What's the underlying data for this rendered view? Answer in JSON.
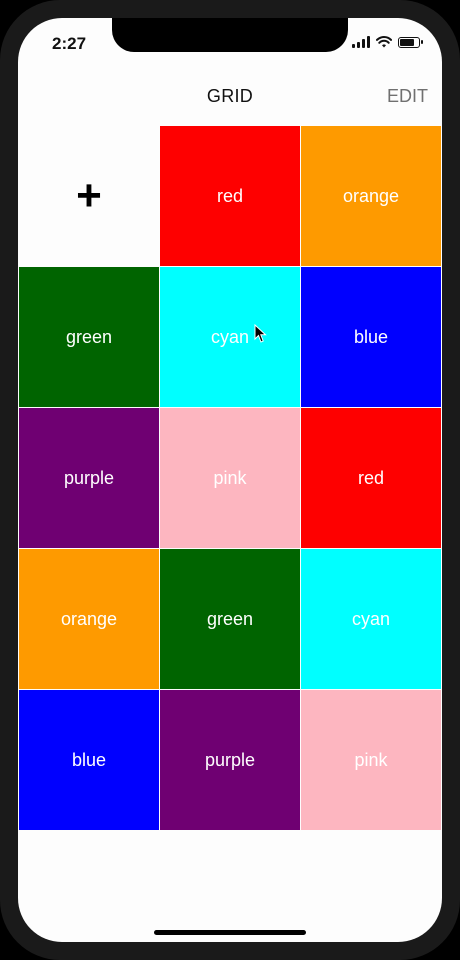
{
  "status_bar": {
    "time": "2:27",
    "battery_level": 0.85
  },
  "navbar": {
    "title": "GRID",
    "edit_label": "EDIT"
  },
  "grid": {
    "add_symbol": "+",
    "tiles": [
      {
        "label": "red",
        "color": "#fe0000"
      },
      {
        "label": "orange",
        "color": "#fe9a00"
      },
      {
        "label": "green",
        "color": "#006400"
      },
      {
        "label": "cyan",
        "color": "#00ffff"
      },
      {
        "label": "blue",
        "color": "#0000ff"
      },
      {
        "label": "purple",
        "color": "#6f0072"
      },
      {
        "label": "pink",
        "color": "#fdb6c0"
      },
      {
        "label": "red",
        "color": "#fe0000"
      },
      {
        "label": "orange",
        "color": "#fe9a00"
      },
      {
        "label": "green",
        "color": "#006400"
      },
      {
        "label": "cyan",
        "color": "#00ffff"
      },
      {
        "label": "blue",
        "color": "#0000ff"
      },
      {
        "label": "purple",
        "color": "#6f0072"
      },
      {
        "label": "pink",
        "color": "#fdb6c0"
      }
    ]
  },
  "cursor_icon": "mouse-pointer-icon"
}
